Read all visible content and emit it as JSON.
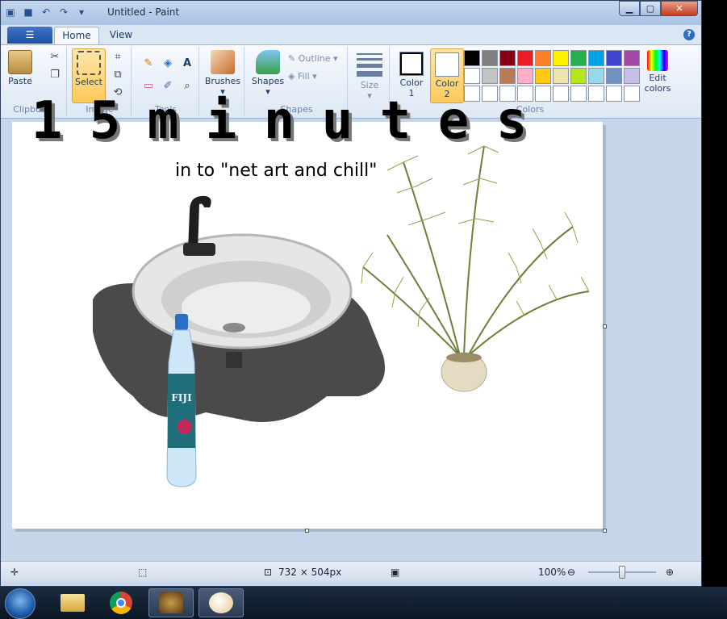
{
  "window": {
    "title": "Untitled - Paint"
  },
  "tabs": {
    "file_icon": "menu-icon",
    "home": "Home",
    "view": "View",
    "help": "?"
  },
  "ribbon": {
    "clipboard": {
      "paste": "Paste",
      "group": "Clipboard"
    },
    "image": {
      "select": "Select",
      "group": "Image"
    },
    "tools": {
      "group": "Tools",
      "text_tool": "A"
    },
    "brushes": "Brushes",
    "shapes": {
      "label": "Shapes",
      "outline": "Outline",
      "fill": "Fill",
      "group": "Shapes"
    },
    "size": "Size",
    "color1": {
      "line1": "Color",
      "line2": "1"
    },
    "color2": {
      "line1": "Color",
      "line2": "2"
    },
    "colors_group": "Colors",
    "edit_colors": {
      "line1": "Edit",
      "line2": "colors"
    }
  },
  "palette": [
    "#000000",
    "#7f7f7f",
    "#880015",
    "#ed1c24",
    "#ff7f27",
    "#fff200",
    "#22b14c",
    "#00a2e8",
    "#3f48cc",
    "#a349a4",
    "#ffffff",
    "#c3c3c3",
    "#b97a57",
    "#ffaec9",
    "#ffc90e",
    "#efe4b0",
    "#b5e61d",
    "#99d9ea",
    "#7092be",
    "#c8bfe7",
    "#ffffff",
    "#ffffff",
    "#ffffff",
    "#ffffff",
    "#ffffff",
    "#ffffff",
    "#ffffff",
    "#ffffff",
    "#ffffff",
    "#ffffff"
  ],
  "canvas": {
    "big_letters": [
      "1",
      "5",
      "m",
      "i",
      "n",
      "u",
      "t",
      "e",
      "s"
    ],
    "subtitle": "in to \"net art and chill\"",
    "bottle_label": "FIJI"
  },
  "status": {
    "canvas_size": "732 × 504px",
    "zoom": "100%"
  }
}
